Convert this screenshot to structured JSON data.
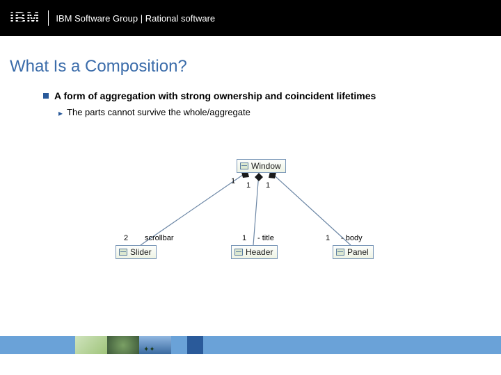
{
  "header": {
    "logo_text": "IBM",
    "breadcrumb": "IBM Software Group | Rational software"
  },
  "slide": {
    "title": "What Is a Composition?",
    "main_bullet": "A form of aggregation with strong ownership and coincident lifetimes",
    "sub_bullet": "The parts cannot survive the whole/aggregate"
  },
  "diagram": {
    "whole": "Window",
    "parts": [
      {
        "name": "Slider",
        "role": "scrollbar",
        "mult_whole": "1",
        "mult_part": "2"
      },
      {
        "name": "Header",
        "role": "- title",
        "mult_whole": "1",
        "mult_part": "1"
      },
      {
        "name": "Panel",
        "role": "- body",
        "mult_whole": "1",
        "mult_part": "1"
      }
    ]
  }
}
